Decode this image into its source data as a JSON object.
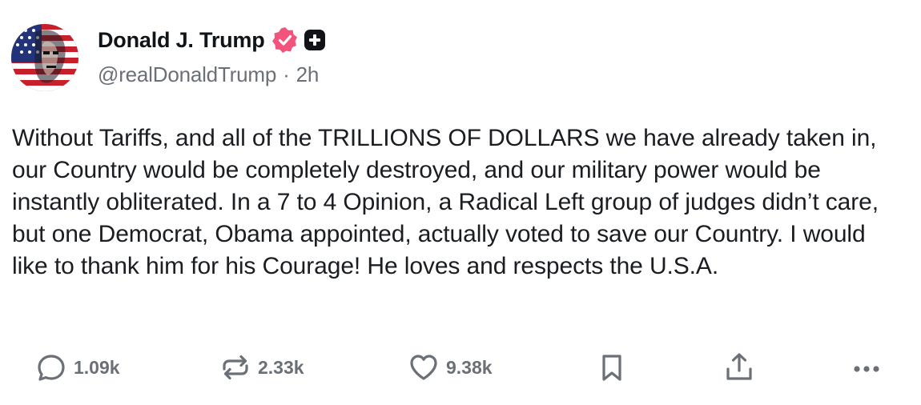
{
  "post": {
    "author": {
      "display_name": "Donald J. Trump",
      "handle": "@realDonaldTrump",
      "separator": "·",
      "time_ago": "2h",
      "verified_color": "#f2547d"
    },
    "body": "Without Tariffs, and all of the TRILLIONS OF DOLLARS we have already taken in, our Country would be completely destroyed, and our military power would be instantly obliterated. In a 7 to 4 Opinion, a Radical Left group of judges didn’t care, but one Democrat, Obama appointed, actually voted to save our Country. I would like to thank him for his Courage! He loves and respects the U.S.A.",
    "actions": {
      "replies": "1.09k",
      "reposts": "2.33k",
      "likes": "9.38k"
    },
    "icons": {
      "reply": "speech-bubble-icon",
      "repost": "repost-arrows-icon",
      "like": "heart-icon",
      "bookmark": "bookmark-icon",
      "share": "share-upload-icon",
      "more": "more-dots-icon"
    }
  }
}
